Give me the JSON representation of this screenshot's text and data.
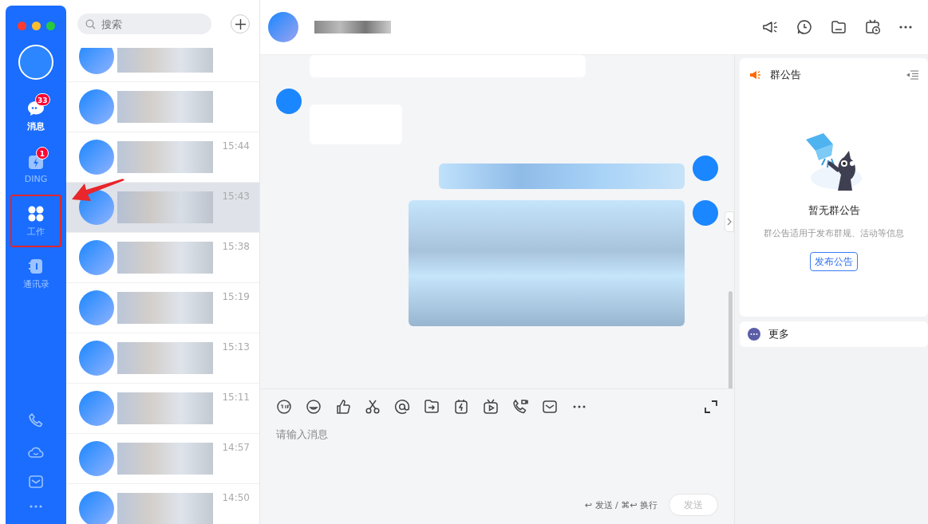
{
  "sidebar": {
    "nav": [
      {
        "kind": "chat",
        "label": "消息",
        "badge": "33",
        "selected": true,
        "annotated": false
      },
      {
        "kind": "ding",
        "label": "DING",
        "badge": "1",
        "selected": false,
        "annotated": false
      },
      {
        "kind": "work",
        "label": "工作",
        "selected": false,
        "annotated": true
      },
      {
        "kind": "contacts",
        "label": "通讯录",
        "selected": false,
        "annotated": false
      }
    ]
  },
  "chat_list": {
    "search": {
      "placeholder": "搜索"
    },
    "items": [
      {
        "selected": false
      },
      {
        "selected": false
      },
      {
        "time": "15:44",
        "selected": false
      },
      {
        "time": "15:43",
        "selected": true
      },
      {
        "time": "15:38",
        "selected": false
      },
      {
        "time": "15:19",
        "selected": false
      },
      {
        "time": "15:13",
        "selected": false
      },
      {
        "time": "15:11",
        "selected": false
      },
      {
        "time": "14:57",
        "selected": false
      },
      {
        "time": "14:50",
        "selected": false
      }
    ]
  },
  "conversation": {
    "messages": [
      {
        "kind": "incoming"
      },
      {
        "kind": "incoming"
      },
      {
        "kind": "outgoing"
      },
      {
        "kind": "outgoing"
      }
    ],
    "input": {
      "placeholder": "请输入消息",
      "hint": "↩ 发送 / ⌘↩ 换行",
      "send_button": {
        "label": "发送",
        "disabled": true
      }
    }
  },
  "announcement_panel": {
    "title": "群公告",
    "empty_title": "暂无群公告",
    "empty_text": "群公告适用于发布群规、活动等信息",
    "publish_button": "发布公告",
    "more": "更多"
  }
}
